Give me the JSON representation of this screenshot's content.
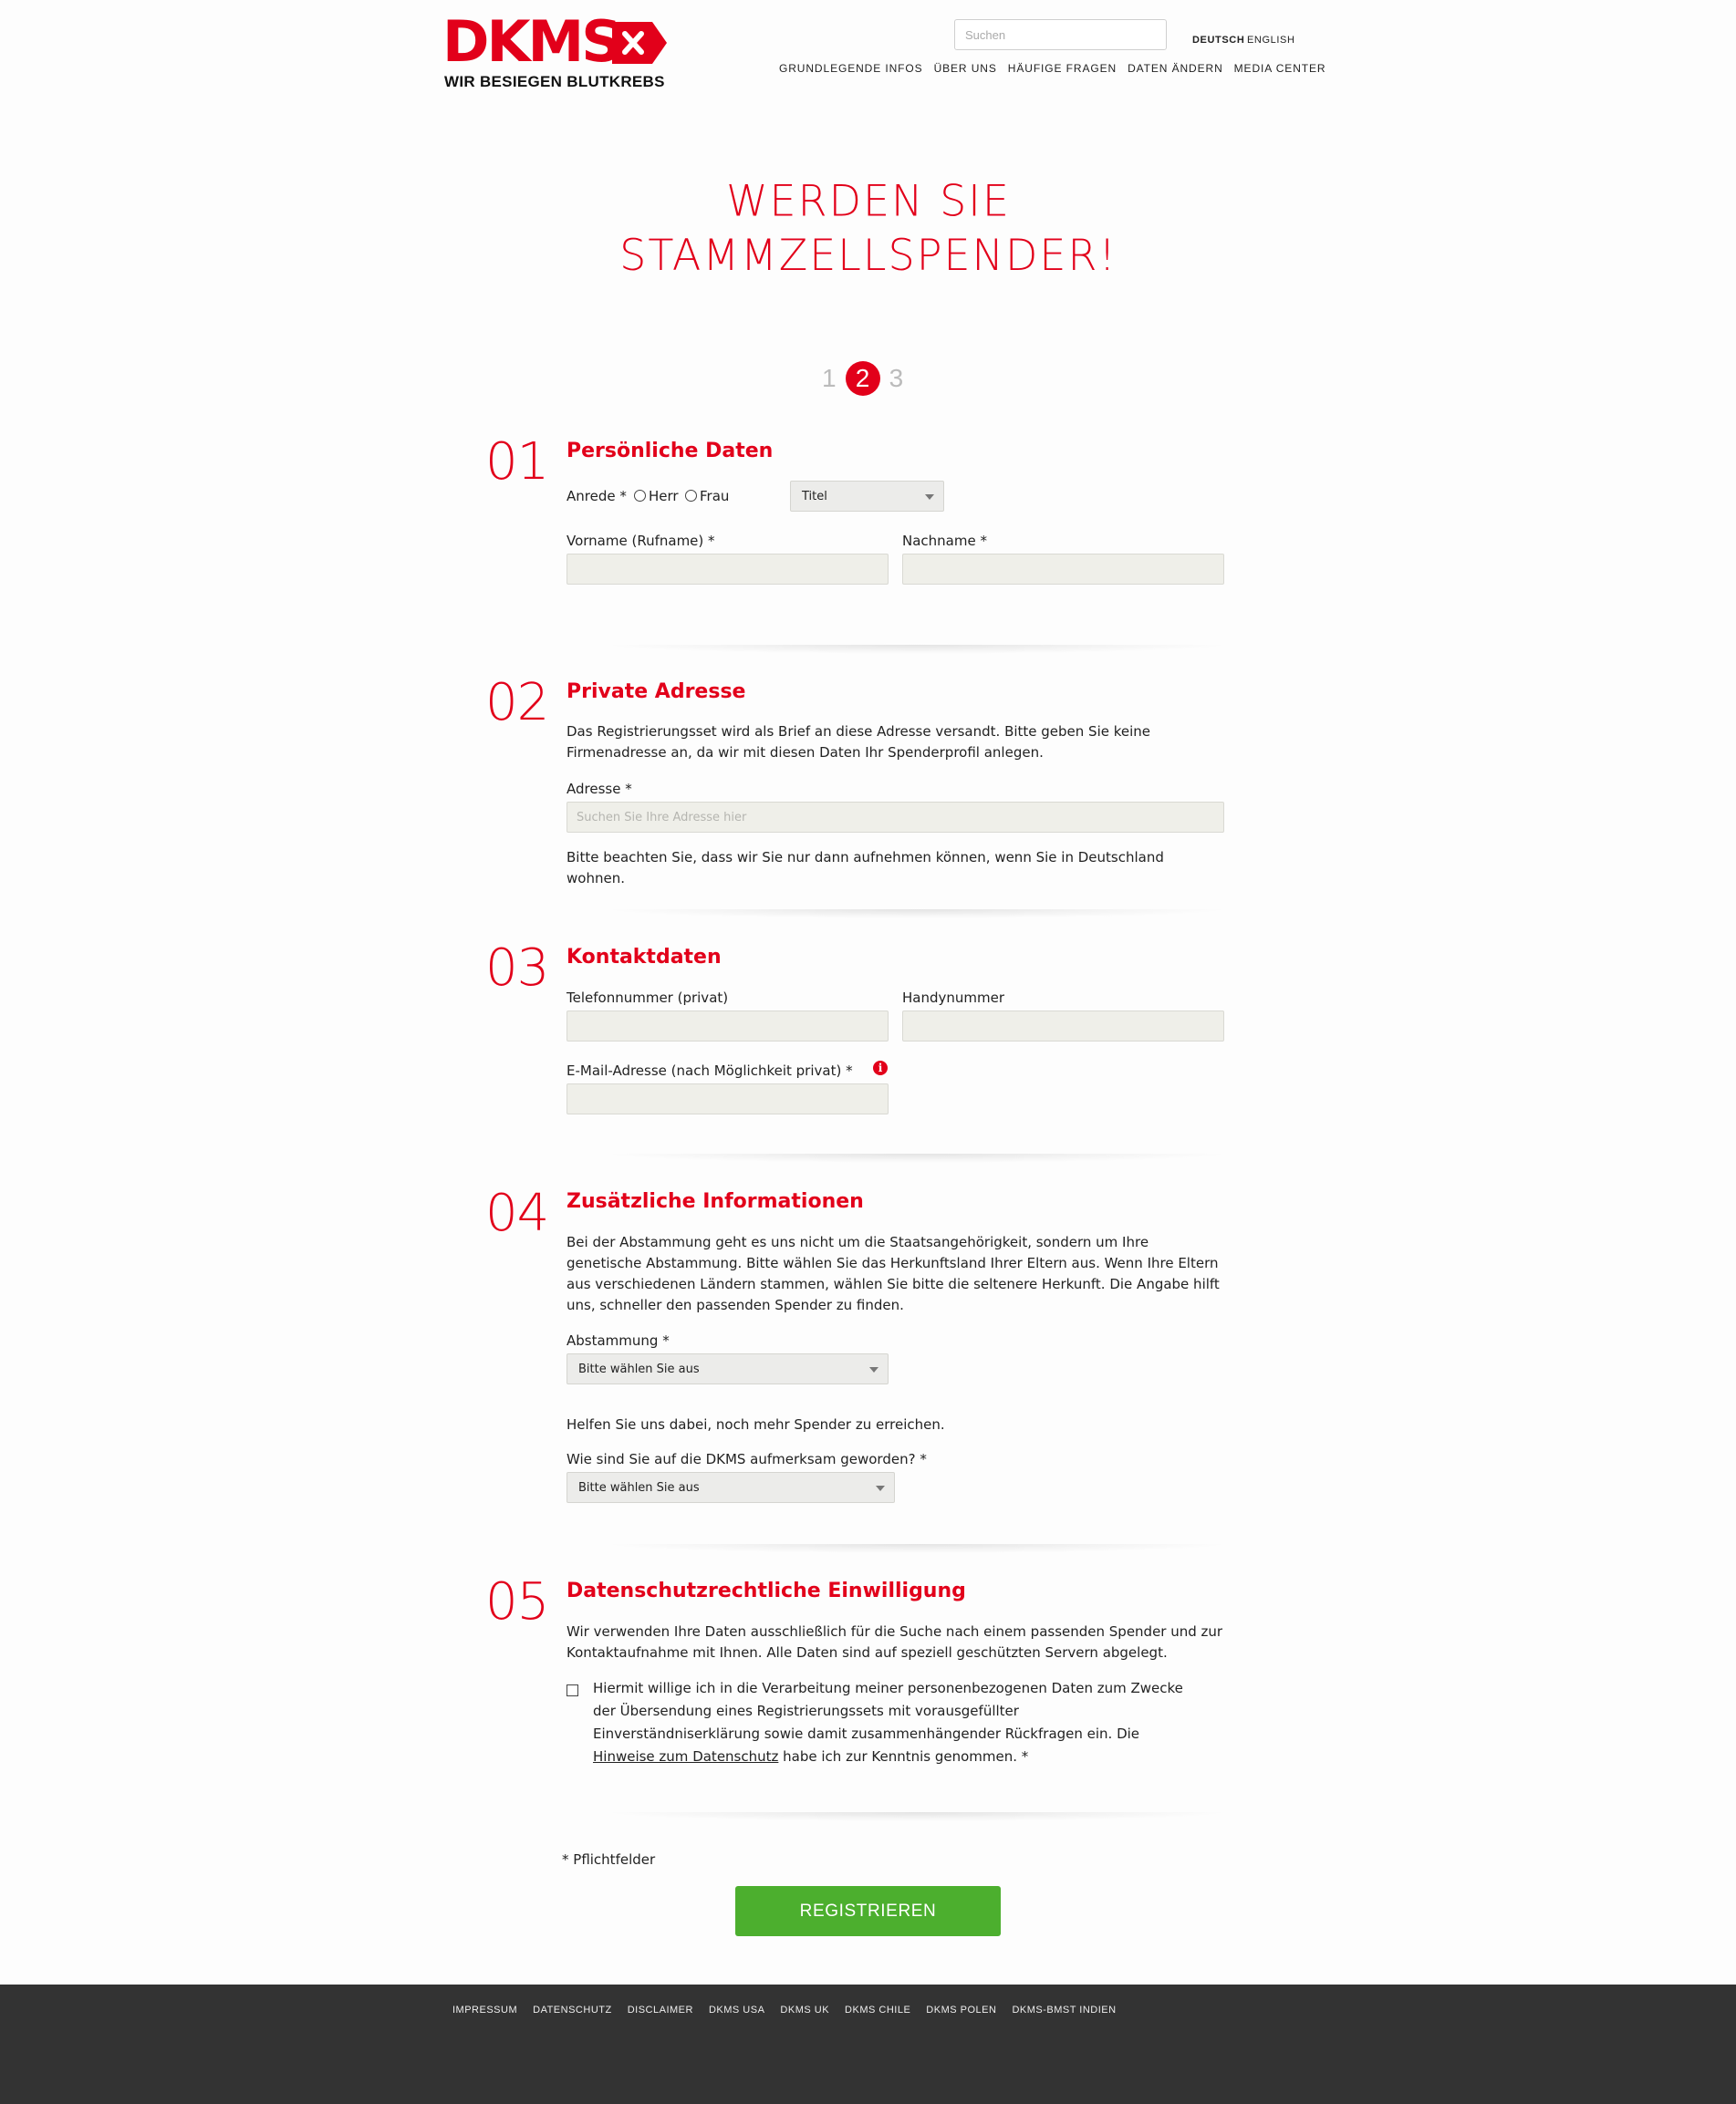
{
  "header": {
    "logo_word": "DKMS",
    "logo_tagline": "WIR BESIEGEN BLUTKREBS",
    "search_placeholder": "Suchen",
    "lang_de": "DEUTSCH",
    "lang_en": "ENGLISH",
    "nav": [
      "GRUNDLEGENDE INFOS",
      "ÜBER UNS",
      "HÄUFIGE FRAGEN",
      "DATEN ÄNDERN",
      "MEDIA CENTER"
    ]
  },
  "hero": {
    "line1": "WERDEN SIE",
    "line2": "STAMMZELLSPENDER!"
  },
  "steps": {
    "step1": "1",
    "step2": "2",
    "step3": "3",
    "current": 2
  },
  "sections": {
    "s1": {
      "number": "01",
      "title": "Persönliche Daten",
      "anrede_label": "Anrede *",
      "herr": "Herr",
      "frau": "Frau",
      "titel_value": "Titel",
      "vorname_label": "Vorname (Rufname) *",
      "nachname_label": "Nachname *"
    },
    "s2": {
      "number": "02",
      "title": "Private Adresse",
      "intro": "Das Registrierungsset wird als Brief an diese Adresse versandt. Bitte geben Sie keine Firmenadresse an, da wir mit diesen Daten Ihr Spenderprofil anlegen.",
      "adresse_label": "Adresse *",
      "adresse_placeholder": "Suchen Sie Ihre Adresse hier",
      "note": "Bitte beachten Sie, dass wir Sie nur dann aufnehmen können, wenn Sie in Deutschland wohnen."
    },
    "s3": {
      "number": "03",
      "title": "Kontaktdaten",
      "telefon_label": "Telefonnummer (privat)",
      "handy_label": "Handynummer",
      "email_label": "E-Mail-Adresse (nach Möglichkeit privat) *",
      "info_glyph": "i"
    },
    "s4": {
      "number": "04",
      "title": "Zusätzliche Informationen",
      "intro": "Bei der Abstammung geht es uns nicht um die Staatsangehörigkeit, sondern um Ihre genetische Abstammung. Bitte wählen Sie das Herkunftsland Ihrer Eltern aus. Wenn Ihre Eltern aus verschiedenen Ländern stammen, wählen Sie bitte die seltenere Herkunft. Die Angabe hilft uns, schneller den passenden Spender zu finden.",
      "abstammung_label": "Abstammung *",
      "abstammung_value": "Bitte wählen Sie aus",
      "help_text": "Helfen Sie uns dabei, noch mehr Spender zu erreichen.",
      "aufmerksam_label": "Wie sind Sie auf die DKMS aufmerksam geworden? *",
      "aufmerksam_value": "Bitte wählen Sie aus"
    },
    "s5": {
      "number": "05",
      "title": "Datenschutzrechtliche Einwilligung",
      "intro": "Wir verwenden Ihre Daten ausschließlich für die Suche nach einem passenden Spender und zur Kontaktaufnahme mit Ihnen. Alle Daten sind auf speziell geschützten Servern abgelegt.",
      "consent_before": "Hiermit willige ich in die Verarbeitung meiner personenbezogenen Daten zum Zwecke der Übersendung eines Registrierungssets mit vorausgefüllter Einverständniserklärung sowie damit zusammenhängender Rückfragen ein. Die ",
      "consent_link": "Hinweise zum Datenschutz",
      "consent_after": " habe ich zur Kenntnis genommen. *"
    }
  },
  "required_note": "* Pflichtfelder",
  "submit_label": "REGISTRIEREN",
  "footer": [
    "IMPRESSUM",
    "DATENSCHUTZ",
    "DISCLAIMER",
    "DKMS USA",
    "DKMS UK",
    "DKMS CHILE",
    "DKMS POLEN",
    "DKMS-BMST INDIEN"
  ],
  "colors": {
    "brand_red": "#e2001a",
    "button_green": "#4caf2e",
    "footer_bg": "#333333"
  }
}
